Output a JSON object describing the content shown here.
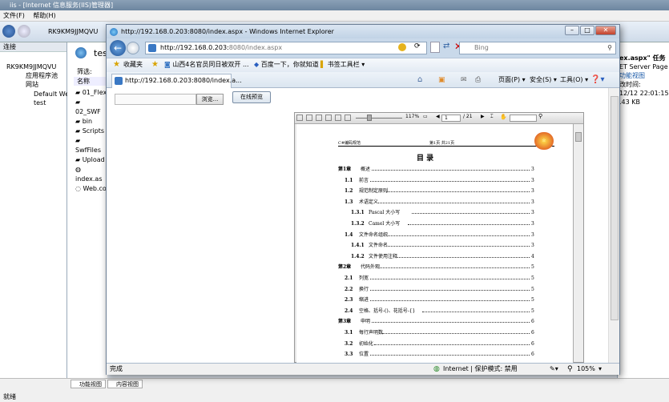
{
  "bg": {
    "title": "iis - [Internet 信息服务(IIS)管理器]",
    "menu": [
      "文件(F)",
      "帮助(H)"
    ],
    "address": "RK9KM9JJMQVU",
    "connections_label": "连接",
    "tree": [
      "RK9KM9JJMQVU",
      "应用程序池",
      "网站",
      "Default We",
      "test"
    ],
    "panel_title": "test",
    "filter_label": "筛选:",
    "name_header": "名称",
    "files": [
      "01_Flex",
      "02_SWF",
      "bin",
      "Scripts",
      "SwfFiles",
      "Upload",
      "index.as",
      "Web.co"
    ],
    "right_lines": [
      "ex.aspx\" 任务",
      "ET Server Page",
      "功能视图",
      "改时间:",
      "12/12 22:01:15",
      "",
      ".43 KB"
    ],
    "bottom_tabs": [
      "功能视图",
      "内容视图"
    ],
    "status": "就绪"
  },
  "ie": {
    "title": "http://192.168.0.203:8080/index.aspx - Windows Internet Explorer",
    "url_host": "http://192.168.0.203:",
    "url_rest": "8080/index.aspx",
    "search_placeholder": "Bing",
    "favorites_label": "收藏夹",
    "fav_items": [
      "山西4名官员同日被双开 ...",
      "百度一下，你就知道",
      "书签工具栏 ▾"
    ],
    "tab_title": "http://192.168.0.203:8080/index.a...",
    "cmd_items": [
      "页面(P) ▾",
      "安全(S) ▾",
      "工具(O) ▾"
    ],
    "status_done": "完成",
    "zone_label": "Internet | 保护模式: 禁用",
    "zoom": "105%"
  },
  "page": {
    "browse_button": "浏览...",
    "preview_button": "在线预览"
  },
  "viewer": {
    "zoom": "117%",
    "page_input": "1",
    "page_total": "/ 21",
    "doc_header_left": "C#编码规范",
    "doc_header_right": "第1页 共21页",
    "toc_title": "目    录",
    "toc": [
      {
        "num": "第1章",
        "title": "概述",
        "page": "3",
        "level": 0
      },
      {
        "num": "1.1",
        "title": "前言",
        "page": "3",
        "level": 1
      },
      {
        "num": "1.2",
        "title": "规范制定原则",
        "page": "3",
        "level": 1
      },
      {
        "num": "1.3",
        "title": "术语定义",
        "page": "3",
        "level": 1
      },
      {
        "num": "1.3.1",
        "title": "Pascal 大小写",
        "page": "3",
        "level": 2
      },
      {
        "num": "1.3.2",
        "title": "Camel 大小写",
        "page": "3",
        "level": 2
      },
      {
        "num": "1.4",
        "title": "文件命名组织",
        "page": "3",
        "level": 1
      },
      {
        "num": "1.4.1",
        "title": "文件命名",
        "page": "3",
        "level": 2
      },
      {
        "num": "1.4.2",
        "title": "文件使用注释",
        "page": "4",
        "level": 2
      },
      {
        "num": "第2章",
        "title": "代码外观",
        "page": "5",
        "level": 0
      },
      {
        "num": "2.1",
        "title": "列宽",
        "page": "5",
        "level": 1
      },
      {
        "num": "2.2",
        "title": "换行",
        "page": "5",
        "level": 1
      },
      {
        "num": "2.3",
        "title": "缩进",
        "page": "5",
        "level": 1
      },
      {
        "num": "2.4",
        "title": "空格、括号-()、花括号-{}",
        "page": "5",
        "level": 1
      },
      {
        "num": "第3章",
        "title": "申明",
        "page": "6",
        "level": 0
      },
      {
        "num": "3.1",
        "title": "每行声明数",
        "page": "6",
        "level": 1
      },
      {
        "num": "3.2",
        "title": "初始化",
        "page": "6",
        "level": 1
      },
      {
        "num": "3.3",
        "title": "位置",
        "page": "6",
        "level": 1
      }
    ]
  }
}
